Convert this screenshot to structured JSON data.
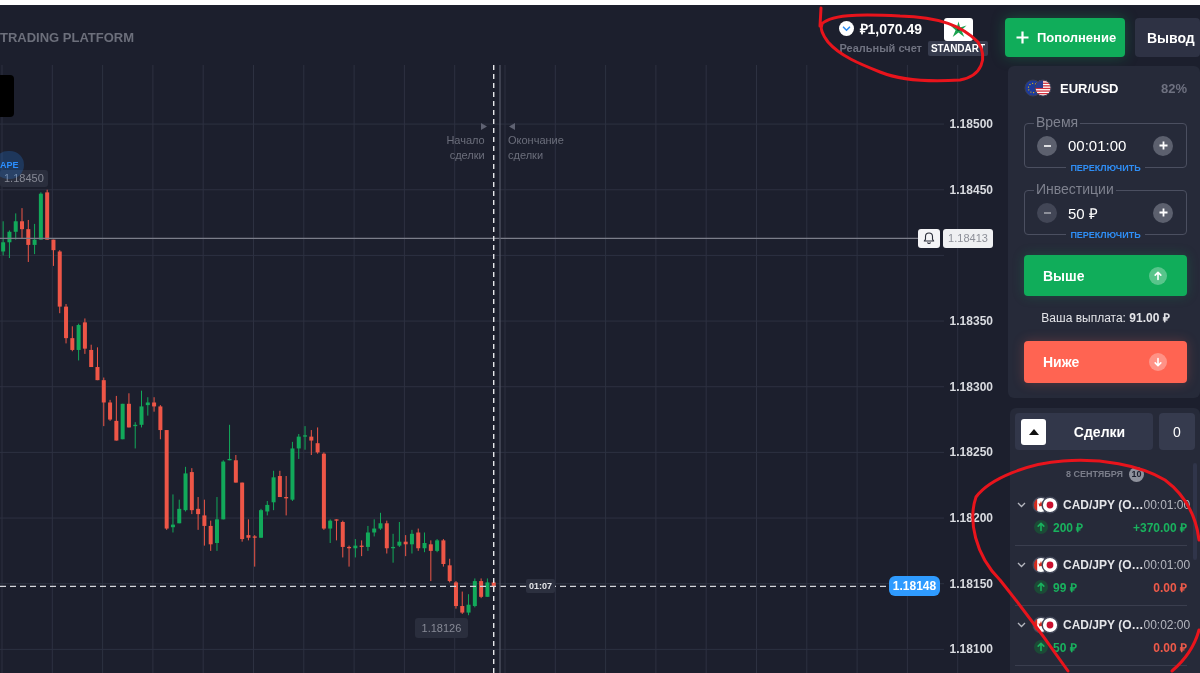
{
  "header": {
    "title": "TRADING PLATFORM",
    "balance": "₽1,070.49",
    "account_type": "Реальный счет",
    "account_badge": "STANDART"
  },
  "header_buttons": [
    {
      "kind": "deposit",
      "label": "Пополнение"
    },
    {
      "kind": "withdraw",
      "label": "Вывод"
    }
  ],
  "chart": {
    "badge": "APE",
    "price_marks": [
      {
        "kind": "high",
        "label": "1.18450"
      },
      {
        "kind": "low",
        "label": "1.18126"
      }
    ],
    "trade": {
      "start_label": "Начало сделки",
      "end_label": "Окончание сделки",
      "timer": "01:07"
    },
    "chart_data": [
      {
        "type": "candlestick",
        "ohlc": [
          [
            1.18403,
            1.18426,
            1.184,
            1.1841
          ],
          [
            1.1841,
            1.18419,
            1.18398,
            1.18418
          ],
          [
            1.18418,
            1.18432,
            1.18412,
            1.18426
          ],
          [
            1.18426,
            1.18436,
            1.18413,
            1.1842
          ],
          [
            1.1842,
            1.18427,
            1.18395,
            1.18408
          ],
          [
            1.18408,
            1.18424,
            1.18401,
            1.18412
          ],
          [
            1.18412,
            1.18448,
            1.18412,
            1.18447
          ],
          [
            1.18448,
            1.1845,
            1.18412,
            1.18412
          ],
          [
            1.18412,
            1.18412,
            1.18392,
            1.18404
          ],
          [
            1.18403,
            1.18404,
            1.18356,
            1.18361
          ],
          [
            1.18361,
            1.18363,
            1.18333,
            1.18337
          ],
          [
            1.18337,
            1.18346,
            1.18327,
            1.18328
          ],
          [
            1.18328,
            1.18348,
            1.1832,
            1.18347
          ],
          [
            1.18349,
            1.18352,
            1.18325,
            1.18329
          ],
          [
            1.18328,
            1.18332,
            1.18315,
            1.18315
          ],
          [
            1.18315,
            1.1833,
            1.18305,
            1.18305
          ],
          [
            1.18305,
            1.18307,
            1.1827,
            1.18288
          ],
          [
            1.18288,
            1.1829,
            1.18274,
            1.18275
          ],
          [
            1.18274,
            1.18293,
            1.18259,
            1.18259
          ],
          [
            1.1826,
            1.18287,
            1.1826,
            1.18287
          ],
          [
            1.18287,
            1.18295,
            1.18269,
            1.18269
          ],
          [
            1.1827,
            1.18273,
            1.18253,
            1.18271
          ],
          [
            1.18271,
            1.18297,
            1.18269,
            1.18285
          ],
          [
            1.18286,
            1.18292,
            1.18278,
            1.18288
          ],
          [
            1.18288,
            1.18292,
            1.18281,
            1.18285
          ],
          [
            1.18285,
            1.18286,
            1.1826,
            1.18267
          ],
          [
            1.18267,
            1.18267,
            1.18191,
            1.18192
          ],
          [
            1.18193,
            1.18218,
            1.18189,
            1.18195
          ],
          [
            1.18196,
            1.18214,
            1.18196,
            1.18207
          ],
          [
            1.18206,
            1.18239,
            1.18205,
            1.18234
          ],
          [
            1.18235,
            1.18238,
            1.18203,
            1.18206
          ],
          [
            1.18207,
            1.18216,
            1.18191,
            1.18203
          ],
          [
            1.18202,
            1.18214,
            1.18179,
            1.18194
          ],
          [
            1.18194,
            1.18198,
            1.18175,
            1.1818
          ],
          [
            1.18181,
            1.18216,
            1.18175,
            1.18199
          ],
          [
            1.18199,
            1.18244,
            1.18199,
            1.18243
          ],
          [
            1.18244,
            1.18271,
            1.18244,
            1.18245
          ],
          [
            1.18244,
            1.18248,
            1.18227,
            1.18227
          ],
          [
            1.18227,
            1.18227,
            1.18182,
            1.18184
          ],
          [
            1.18187,
            1.18199,
            1.18183,
            1.18185
          ],
          [
            1.18186,
            1.18187,
            1.18163,
            1.18185
          ],
          [
            1.18185,
            1.18207,
            1.18185,
            1.18206
          ],
          [
            1.18205,
            1.18213,
            1.18202,
            1.1821
          ],
          [
            1.18212,
            1.18236,
            1.18206,
            1.18231
          ],
          [
            1.18232,
            1.18236,
            1.18216,
            1.18216
          ],
          [
            1.18216,
            1.18232,
            1.18202,
            1.18215
          ],
          [
            1.18214,
            1.18258,
            1.18213,
            1.18253
          ],
          [
            1.18253,
            1.18264,
            1.18245,
            1.18262
          ],
          [
            1.18262,
            1.1827,
            1.18252,
            1.18263
          ],
          [
            1.18262,
            1.18267,
            1.18248,
            1.18259
          ],
          [
            1.18257,
            1.18269,
            1.18249,
            1.1825
          ],
          [
            1.18249,
            1.1825,
            1.18191,
            1.18192
          ],
          [
            1.18192,
            1.18199,
            1.18181,
            1.18198
          ],
          [
            1.18199,
            1.18199,
            1.18183,
            1.18198
          ],
          [
            1.18197,
            1.18198,
            1.1817,
            1.18178
          ],
          [
            1.18178,
            1.18179,
            1.18163,
            1.18177
          ],
          [
            1.18177,
            1.18184,
            1.1817,
            1.18179
          ],
          [
            1.18179,
            1.18183,
            1.18171,
            1.18178
          ],
          [
            1.18178,
            1.18194,
            1.18175,
            1.18189
          ],
          [
            1.18189,
            1.18199,
            1.18186,
            1.18192
          ],
          [
            1.18192,
            1.18204,
            1.18191,
            1.18196
          ],
          [
            1.18196,
            1.18198,
            1.18173,
            1.18177
          ],
          [
            1.18177,
            1.18188,
            1.18166,
            1.18178
          ],
          [
            1.18179,
            1.18197,
            1.18178,
            1.18182
          ],
          [
            1.18182,
            1.18187,
            1.18171,
            1.1818
          ],
          [
            1.1818,
            1.18191,
            1.18173,
            1.18188
          ],
          [
            1.18189,
            1.18192,
            1.18175,
            1.18177
          ],
          [
            1.18177,
            1.18189,
            1.18174,
            1.18181
          ],
          [
            1.1818,
            1.18183,
            1.18152,
            1.18175
          ],
          [
            1.18175,
            1.18184,
            1.18174,
            1.18183
          ],
          [
            1.18183,
            1.18184,
            1.18163,
            1.18165
          ],
          [
            1.18164,
            1.18169,
            1.18151,
            1.18152
          ],
          [
            1.18151,
            1.18152,
            1.18131,
            1.18133
          ],
          [
            1.18133,
            1.18144,
            1.18127,
            1.18128
          ],
          [
            1.18128,
            1.18142,
            1.18126,
            1.18134
          ],
          [
            1.18133,
            1.18154,
            1.18132,
            1.18152
          ],
          [
            1.18152,
            1.18154,
            1.18139,
            1.1814
          ],
          [
            1.1814,
            1.18154,
            1.1814,
            1.18151
          ],
          [
            1.18151,
            1.18152,
            1.18146,
            1.18148
          ],
          null,
          null,
          null,
          null,
          null,
          null,
          null,
          null,
          null,
          null,
          null,
          null,
          null,
          null,
          null,
          null,
          null,
          null,
          null,
          null,
          null,
          null,
          null,
          null,
          null,
          null,
          null,
          null,
          null,
          null,
          null,
          null,
          null,
          null,
          null,
          null,
          null,
          null,
          null,
          null,
          null,
          null,
          null,
          null,
          null,
          null,
          null,
          null,
          null,
          null,
          null,
          null,
          null,
          null,
          null,
          null,
          null,
          null,
          null,
          null,
          null,
          null,
          null,
          null,
          null,
          null,
          null,
          null,
          null,
          null,
          null,
          null,
          null,
          null,
          null,
          null,
          null,
          null,
          null,
          null
        ],
        "ylim": [
          1.18082,
          1.18545
        ],
        "yticks": [
          {
            "value": 1.185,
            "label": "1.18500"
          },
          {
            "value": 1.1845,
            "label": "1.18450"
          },
          {
            "value": 1.1835,
            "label": "1.18350"
          },
          {
            "value": 1.183,
            "label": "1.18300"
          },
          {
            "value": 1.1825,
            "label": "1.18250"
          },
          {
            "value": 1.182,
            "label": "1.18200"
          },
          {
            "value": 1.1815,
            "label": "1.18150"
          },
          {
            "value": 1.181,
            "label": "1.18100"
          }
        ],
        "tick_labels": "y",
        "grid": true,
        "ref_lines": [
          {
            "axis": "y",
            "value": 1.18413,
            "label": "1.18413",
            "line_style": "solid"
          },
          {
            "axis": "y",
            "value": 1.18148,
            "label": "1.18148",
            "line_style": "dashed"
          }
        ]
      }
    ]
  },
  "trade_panel": {
    "asset": "EUR/USD",
    "payout_percent": "82%",
    "fields": [
      {
        "label": "Время",
        "value": "00:01:00",
        "switch": "ПЕРЕКЛЮЧИТЬ",
        "minus_disabled": false
      },
      {
        "label": "Инвестиции",
        "value": "50 ₽",
        "switch": "ПЕРЕКЛЮЧИТЬ",
        "minus_disabled": true
      }
    ],
    "actions": [
      {
        "kind": "up",
        "label": "Выше"
      },
      {
        "kind": "payout",
        "text": "Ваша выплата: **91.00 ₽**"
      },
      {
        "kind": "down",
        "label": "Ниже"
      }
    ]
  },
  "deals": {
    "title": "Сделки",
    "count": "0",
    "groups": [
      {
        "date": "8 СЕНТЯБРЯ",
        "badge": "10",
        "items": [
          {
            "expanded": false,
            "pair": "CAD/JPY (O…",
            "duration": "00:01:00",
            "up": true,
            "amount": "200 ₽",
            "result": "+370.00 ₽",
            "won": true
          },
          {
            "expanded": false,
            "pair": "CAD/JPY (O…",
            "duration": "00:01:00",
            "up": true,
            "amount": "99 ₽",
            "result": "0.00 ₽",
            "won": false
          },
          {
            "expanded": false,
            "pair": "CAD/JPY (O…",
            "duration": "00:02:00",
            "up": true,
            "amount": "50 ₽",
            "result": "0.00 ₽",
            "won": false
          }
        ]
      }
    ]
  }
}
